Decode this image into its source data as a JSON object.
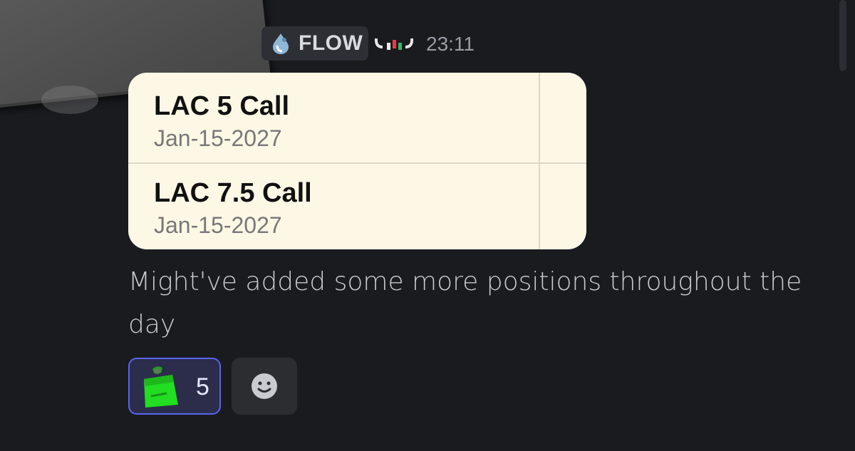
{
  "header": {
    "role_tag": "FLOW",
    "timestamp": "23:11"
  },
  "attachment": {
    "rows": [
      {
        "title": "LAC 5 Call",
        "date": "Jan-15-2027"
      },
      {
        "title": "LAC 7.5 Call",
        "date": "Jan-15-2027"
      }
    ]
  },
  "message": {
    "text": "Might've added some more positions throughout the day"
  },
  "reactions": [
    {
      "emoji": "green-bag-icon",
      "count": "5",
      "selected": true
    }
  ],
  "icons": {
    "role": "water-drop-icon",
    "badge": "bull-icon",
    "add_reaction": "smiley-icon"
  },
  "colors": {
    "background": "#1a1b1f",
    "accent": "#5865f2",
    "card": "#fdf8e6"
  }
}
